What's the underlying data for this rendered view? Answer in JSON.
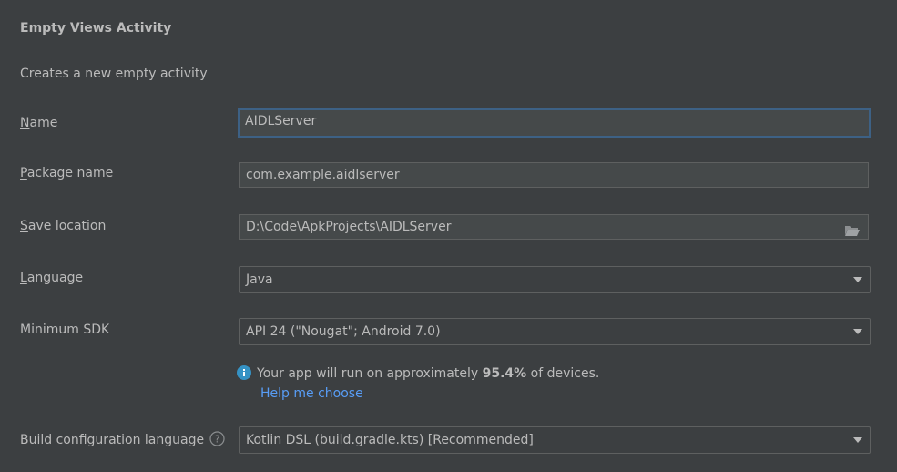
{
  "title": "Empty Views Activity",
  "subtitle": "Creates a new empty activity",
  "fields": {
    "name": {
      "label_mnemonic": "N",
      "label_rest": "ame",
      "value": "AIDLServer"
    },
    "package": {
      "label_mnemonic": "P",
      "label_rest": "ackage name",
      "value": "com.example.aidlserver"
    },
    "save_location": {
      "label_mnemonic": "S",
      "label_rest": "ave location",
      "value": "D:\\Code\\ApkProjects\\AIDLServer"
    },
    "language": {
      "label_mnemonic": "L",
      "label_rest": "anguage",
      "value": "Java"
    },
    "min_sdk": {
      "label": "Minimum SDK",
      "value": "API 24 (\"Nougat\"; Android 7.0)"
    },
    "build_config": {
      "label": "Build configuration language",
      "value": "Kotlin DSL (build.gradle.kts) [Recommended]"
    }
  },
  "info": {
    "prefix": "Your app will run on approximately ",
    "percent": "95.4%",
    "suffix": " of devices.",
    "link": "Help me choose"
  },
  "icons": {
    "folder": "folder-icon",
    "info": "info-icon",
    "help": "help-icon",
    "dropdown": "chevron-down-icon"
  },
  "colors": {
    "background": "#3c3f41",
    "field_background": "#45494a",
    "text": "#bbbbbb",
    "link": "#589df6",
    "focus_border": "#3d6185",
    "info_icon": "#3592c4"
  }
}
